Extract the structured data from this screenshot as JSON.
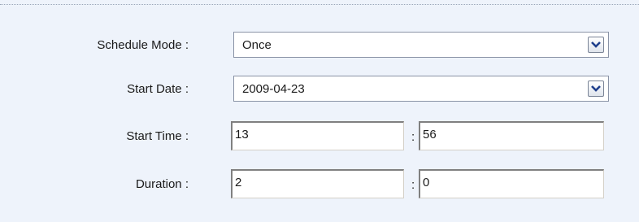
{
  "schedule_mode": {
    "label": "Schedule Mode :",
    "value": "Once"
  },
  "start_date": {
    "label": "Start Date :",
    "value": "2009-04-23"
  },
  "start_time": {
    "label": "Start Time :",
    "hour": "13",
    "separator": ":",
    "minute": "56"
  },
  "duration": {
    "label": "Duration :",
    "hour": "2",
    "separator": ":",
    "minute": "0"
  },
  "icons": {
    "dropdown": "chevron-down-icon"
  }
}
